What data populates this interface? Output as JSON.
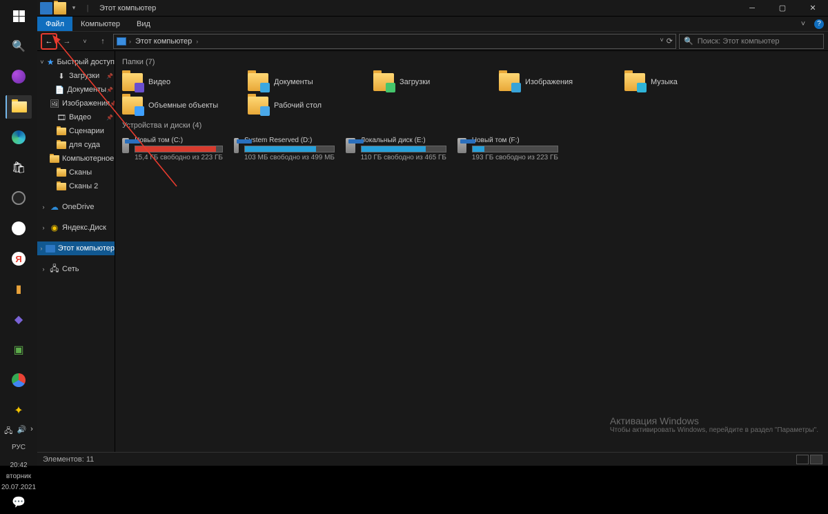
{
  "window": {
    "title": "Этот компьютер",
    "menu": {
      "file": "Файл",
      "computer": "Компьютер",
      "view": "Вид"
    },
    "address": {
      "location": "Этот компьютер"
    },
    "search_placeholder": "Поиск: Этот компьютер"
  },
  "tree": {
    "quick_access": "Быстрый доступ",
    "items": [
      "Загрузки",
      "Документы",
      "Изображения",
      "Видео",
      "Сценарии",
      "для суда",
      "Компьютерное же",
      "Сканы",
      "Сканы 2"
    ],
    "onedrive": "OneDrive",
    "yadisk": "Яндекс.Диск",
    "this_pc": "Этот компьютер",
    "network": "Сеть"
  },
  "content": {
    "folders_header": "Папки (7)",
    "folders": [
      {
        "name": "Видео",
        "badge": "#6a4fce"
      },
      {
        "name": "Документы",
        "badge": "#3aa7e0"
      },
      {
        "name": "Загрузки",
        "badge": "#45c56c"
      },
      {
        "name": "Изображения",
        "badge": "#38a3d8"
      },
      {
        "name": "Музыка",
        "badge": "#2fb4d8"
      },
      {
        "name": "Объемные объекты",
        "badge": "#3fa0ff"
      },
      {
        "name": "Рабочий стол",
        "badge": "#4aa8e8"
      }
    ],
    "drives_header": "Устройства и диски (4)",
    "drives": [
      {
        "name": "Новый том (C:)",
        "free": "15,4 ГБ свободно из 223 ГБ",
        "fill": 93,
        "color": "#d83b2e"
      },
      {
        "name": "System Reserved (D:)",
        "free": "103 МБ свободно из 499 МБ",
        "fill": 80,
        "color": "#26a0da"
      },
      {
        "name": "Локальный диск (E:)",
        "free": "110 ГБ свободно из 465 ГБ",
        "fill": 76,
        "color": "#26a0da"
      },
      {
        "name": "Новый том (F:)",
        "free": "193 ГБ свободно из 223 ГБ",
        "fill": 14,
        "color": "#26a0da"
      }
    ]
  },
  "status": {
    "items": "Элементов: 11"
  },
  "watermark": {
    "title": "Активация Windows",
    "sub": "Чтобы активировать Windows, перейдите в раздел \"Параметры\"."
  },
  "clock": {
    "time": "20:42",
    "day": "вторник",
    "date": "20.07.2021",
    "lang": "РУС"
  }
}
